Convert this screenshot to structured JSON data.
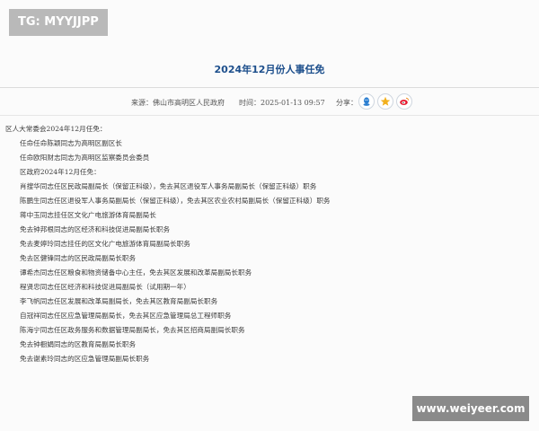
{
  "watermark_top": "TG: MYYJJPP",
  "watermark_bottom": "www.weiyeer.com",
  "article": {
    "title": "2024年12月份人事任免",
    "source": "来源：佛山市高明区人民政府",
    "time": "时间：2025-01-13 09:57",
    "share_label": "分享：",
    "share_icons": [
      "qq-icon",
      "qzone-star-icon",
      "weibo-icon"
    ]
  },
  "lines": [
    "区人大常委会2024年12月任免：",
    "任命任命陈颖同志为高明区副区长",
    "任命欧阳财志同志为高明区监察委员会委员",
    "区政府2024年12月任免：",
    "肖搜华同志任区民政局副局长（保留正科级），免去其区退役军人事务局副局长（保留正科级）职务",
    "陈鹏生同志任区退役军人事务局副局长（保留正科级），免去其区农业农村局副局长（保留正科级）职务",
    "蒋中玉同志挂任区文化广电旅游体育局副局长",
    "免去钟邦根同志的区经济和科技促进局副局长职务",
    "免去麦婷玲同志挂任的区文化广电旅游体育局副局长职务",
    "免去区健锋同志的区民政局副局长职务",
    "谭希杰同志任区粮食和物资储备中心主任，免去其区发展和改革局副局长职务",
    "程贤忠同志任区经济和科技促进局副局长（试用期一年）",
    "李飞帆同志任区发展和改革局副局长，免去其区教育局副局长职务",
    "自冠祥同志任区应急管理局副局长，免去其区应急管理局总工程师职务",
    "陈海宁同志任区政务服务和数据管理局副局长，免去其区招商局副局长职务",
    "免去钟橱娟同志的区教育局副局长职务",
    "免去谢素玲同志的区应急管理局副局长职务"
  ]
}
